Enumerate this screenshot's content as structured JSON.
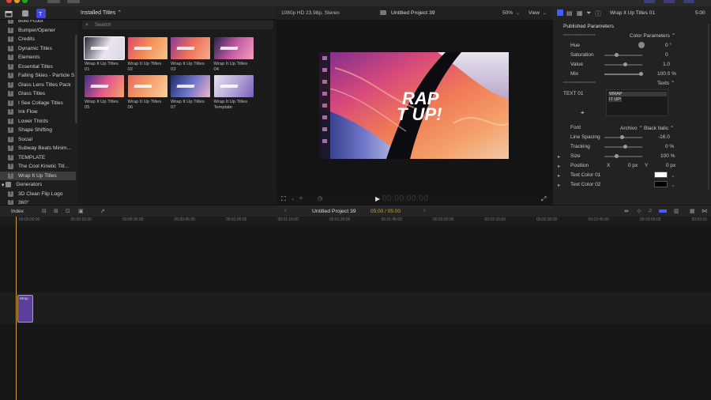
{
  "browser": {
    "header": "Installed Titles ⌃",
    "search_placeholder": "Search",
    "sidebar": [
      {
        "label": "Bold Fcout",
        "type": "item"
      },
      {
        "label": "Bumper/Opener",
        "type": "item"
      },
      {
        "label": "Credits",
        "type": "item"
      },
      {
        "label": "Dynamic Titles",
        "type": "item"
      },
      {
        "label": "Elements",
        "type": "item"
      },
      {
        "label": "Essential Titles",
        "type": "item"
      },
      {
        "label": "Falling Skies - Particle S",
        "type": "item"
      },
      {
        "label": "Glass Lens Titles Pack",
        "type": "item"
      },
      {
        "label": "Glass Titles",
        "type": "item"
      },
      {
        "label": "I See Collage Titles",
        "type": "item"
      },
      {
        "label": "Ink Flow",
        "type": "item"
      },
      {
        "label": "Lower Thirds",
        "type": "item"
      },
      {
        "label": "Shape Shifting",
        "type": "item"
      },
      {
        "label": "Social",
        "type": "item"
      },
      {
        "label": "Subway Beats Minim...",
        "type": "item"
      },
      {
        "label": "TEMPLATE",
        "type": "item"
      },
      {
        "label": "The Cool Kinetic Titl...",
        "type": "item"
      },
      {
        "label": "Wrap It Up Titles",
        "type": "selected"
      },
      {
        "label": "Generators",
        "type": "group"
      },
      {
        "label": "3D Clean Flip Logo",
        "type": "item"
      },
      {
        "label": "360°",
        "type": "item"
      }
    ],
    "thumbnails": [
      {
        "line1": "Wrap It Up Titles",
        "line2": "01"
      },
      {
        "line1": "Wrap It Up Titles",
        "line2": "02"
      },
      {
        "line1": "Wrap It Up Titles",
        "line2": "03"
      },
      {
        "line1": "Wrap It Up Titles",
        "line2": "04"
      },
      {
        "line1": "Wrap It Up Titles",
        "line2": "05"
      },
      {
        "line1": "Wrap It Up Titles",
        "line2": "06"
      },
      {
        "line1": "Wrap It Up Titles",
        "line2": "07"
      },
      {
        "line1": "Wrap It Up Titles",
        "line2": "Template"
      }
    ]
  },
  "viewer": {
    "format": "1080p HD 23.98p, Stereo",
    "project": "Untitled Project 39",
    "zoom": "50%",
    "view_label": "View",
    "canvas_text_line1": "RAP",
    "canvas_text_line2": "T UP!",
    "timecode": "00:00:00:00"
  },
  "inspector": {
    "title": "Wrap It Up Titles 01",
    "duration": "5:00",
    "section": "Published Parameters",
    "color_params_label": "Color Parameters ⌃",
    "divider": "==============",
    "hue_label": "Hue",
    "hue_value": "0 °",
    "saturation_label": "Saturation",
    "saturation_value": "0",
    "value_label": "Value",
    "value_value": "1.0",
    "mix_label": "Mix",
    "mix_value": "100.0 %",
    "texts_label": "Texts ⌃",
    "text01_label": "TEXT 01",
    "text01_line1": "WRAP",
    "text01_line2": "IT UP!",
    "font_label": "Font",
    "font_family": "Archivo ⌃",
    "font_style": "Black Italic ⌃",
    "line_spacing_label": "Line Spacing",
    "line_spacing_value": "-16.0",
    "tracking_label": "Tracking",
    "tracking_value": "0 %",
    "size_label": "Size",
    "size_value": "100 %",
    "position_label": "Position",
    "position_x_label": "X",
    "position_x": "0 px",
    "position_y_label": "Y",
    "position_y": "0 px",
    "text_color1_label": "Text Color 01",
    "text_color2_label": "Text Color 02"
  },
  "timeline": {
    "index_label": "Index",
    "project": "Untitled Project 39",
    "duration": "05:00 / 05:00",
    "clip_label": "Wrap",
    "ruler": [
      "00:00:00:00",
      "00:00:15:00",
      "00:00:30:00",
      "00:00:45:00",
      "00:01:00:00",
      "00:01:15:00",
      "00:01:30:00",
      "00:01:45:00",
      "00:02:00:00",
      "00:02:15:00",
      "00:02:30:00",
      "00:02:45:00",
      "00:03:00:00",
      "00:03:15"
    ]
  },
  "colors": {
    "accent": "#4a5cff",
    "playhead": "#c9a441",
    "clip": "#5d3f9d"
  }
}
